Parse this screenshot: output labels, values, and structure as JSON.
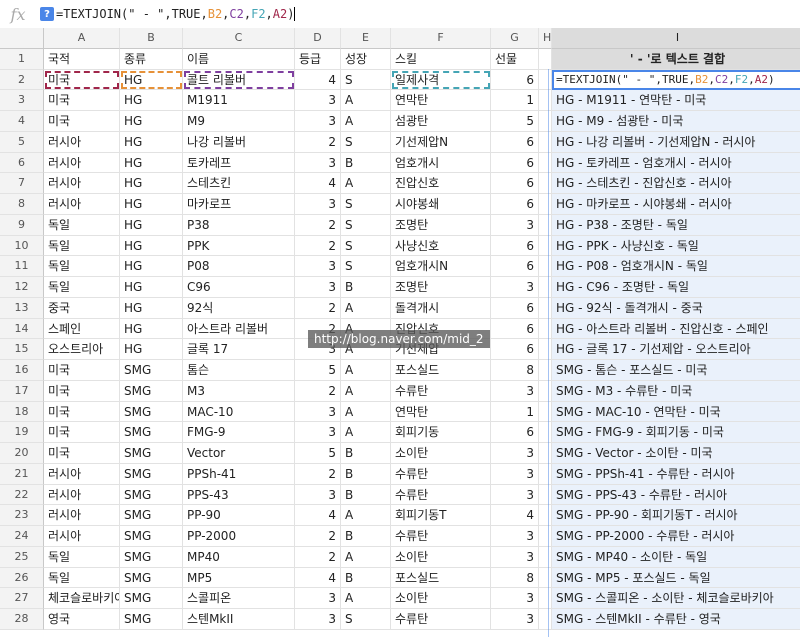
{
  "formula_bar": {
    "fx_label": "fx",
    "help_label": "?",
    "parts": [
      {
        "t": "=TEXTJOIN(\" - \",TRUE,",
        "c": ""
      },
      {
        "t": "B2",
        "c": "t-orange"
      },
      {
        "t": ",",
        "c": ""
      },
      {
        "t": "C2",
        "c": "t-purple"
      },
      {
        "t": ",",
        "c": ""
      },
      {
        "t": "F2",
        "c": "t-teal"
      },
      {
        "t": ",",
        "c": ""
      },
      {
        "t": "A2",
        "c": "t-red"
      },
      {
        "t": ")",
        "c": ""
      }
    ]
  },
  "columns": [
    "A",
    "B",
    "C",
    "D",
    "E",
    "F",
    "G",
    "H",
    "I"
  ],
  "selected_column": "I",
  "headers": {
    "A": "국적",
    "B": "종류",
    "C": "이름",
    "D": "등급",
    "E": "성장",
    "F": "스킬",
    "G": "선물",
    "I": "' - '로 텍스트 결합"
  },
  "rows": [
    {
      "r": "2",
      "A": "미국",
      "B": "HG",
      "C": "콜트 리볼버",
      "D": "4",
      "E": "S",
      "F": "일제사격",
      "G": "6",
      "I": ""
    },
    {
      "r": "3",
      "A": "미국",
      "B": "HG",
      "C": "M1911",
      "D": "3",
      "E": "A",
      "F": "연막탄",
      "G": "1",
      "I": "HG - M1911 - 연막탄 - 미국"
    },
    {
      "r": "4",
      "A": "미국",
      "B": "HG",
      "C": "M9",
      "D": "3",
      "E": "A",
      "F": "섬광탄",
      "G": "5",
      "I": "HG - M9 - 섬광탄 - 미국"
    },
    {
      "r": "5",
      "A": "러시아",
      "B": "HG",
      "C": "나강 리볼버",
      "D": "2",
      "E": "S",
      "F": "기선제압N",
      "G": "6",
      "I": "HG - 나강 리볼버 - 기선제압N - 러시아"
    },
    {
      "r": "6",
      "A": "러시아",
      "B": "HG",
      "C": "토카레프",
      "D": "3",
      "E": "B",
      "F": "엄호개시",
      "G": "6",
      "I": "HG - 토카레프 - 엄호개시 - 러시아"
    },
    {
      "r": "7",
      "A": "러시아",
      "B": "HG",
      "C": "스테츠킨",
      "D": "4",
      "E": "A",
      "F": "진압신호",
      "G": "6",
      "I": "HG - 스테츠킨 - 진압신호 - 러시아"
    },
    {
      "r": "8",
      "A": "러시아",
      "B": "HG",
      "C": "마카로프",
      "D": "3",
      "E": "S",
      "F": "시야봉쇄",
      "G": "6",
      "I": "HG - 마카로프 - 시야봉쇄 - 러시아"
    },
    {
      "r": "9",
      "A": "독일",
      "B": "HG",
      "C": "P38",
      "D": "2",
      "E": "S",
      "F": "조명탄",
      "G": "3",
      "I": "HG - P38 - 조명탄 - 독일"
    },
    {
      "r": "10",
      "A": "독일",
      "B": "HG",
      "C": "PPK",
      "D": "2",
      "E": "S",
      "F": "사냥신호",
      "G": "6",
      "I": "HG - PPK - 사냥신호 - 독일"
    },
    {
      "r": "11",
      "A": "독일",
      "B": "HG",
      "C": "P08",
      "D": "3",
      "E": "S",
      "F": "엄호개시N",
      "G": "6",
      "I": "HG - P08 - 엄호개시N - 독일"
    },
    {
      "r": "12",
      "A": "독일",
      "B": "HG",
      "C": "C96",
      "D": "3",
      "E": "B",
      "F": "조명탄",
      "G": "3",
      "I": "HG - C96 - 조명탄 - 독일"
    },
    {
      "r": "13",
      "A": "중국",
      "B": "HG",
      "C": "92식",
      "D": "2",
      "E": "A",
      "F": "돌격개시",
      "G": "6",
      "I": "HG - 92식 - 돌격개시 - 중국"
    },
    {
      "r": "14",
      "A": "스페인",
      "B": "HG",
      "C": "아스트라 리볼버",
      "D": "2",
      "E": "A",
      "F": "진압신호",
      "G": "6",
      "I": "HG - 아스트라 리볼버 - 진압신호 - 스페인"
    },
    {
      "r": "15",
      "A": "오스트리아",
      "B": "HG",
      "C": "글록 17",
      "D": "3",
      "E": "A",
      "F": "기선제압",
      "G": "6",
      "I": "HG - 글록 17 - 기선제압 - 오스트리아"
    },
    {
      "r": "16",
      "A": "미국",
      "B": "SMG",
      "C": "톰슨",
      "D": "5",
      "E": "A",
      "F": "포스실드",
      "G": "8",
      "I": "SMG - 톰슨 - 포스실드 - 미국"
    },
    {
      "r": "17",
      "A": "미국",
      "B": "SMG",
      "C": "M3",
      "D": "2",
      "E": "A",
      "F": "수류탄",
      "G": "3",
      "I": "SMG - M3 - 수류탄 - 미국"
    },
    {
      "r": "18",
      "A": "미국",
      "B": "SMG",
      "C": "MAC-10",
      "D": "3",
      "E": "A",
      "F": "연막탄",
      "G": "1",
      "I": "SMG - MAC-10 - 연막탄 - 미국"
    },
    {
      "r": "19",
      "A": "미국",
      "B": "SMG",
      "C": "FMG-9",
      "D": "3",
      "E": "A",
      "F": "회피기동",
      "G": "6",
      "I": "SMG - FMG-9 - 회피기동 - 미국"
    },
    {
      "r": "20",
      "A": "미국",
      "B": "SMG",
      "C": "Vector",
      "D": "5",
      "E": "B",
      "F": "소이탄",
      "G": "3",
      "I": "SMG - Vector - 소이탄 - 미국"
    },
    {
      "r": "21",
      "A": "러시아",
      "B": "SMG",
      "C": "PPSh-41",
      "D": "2",
      "E": "B",
      "F": "수류탄",
      "G": "3",
      "I": "SMG - PPSh-41 - 수류탄 - 러시아"
    },
    {
      "r": "22",
      "A": "러시아",
      "B": "SMG",
      "C": "PPS-43",
      "D": "3",
      "E": "B",
      "F": "수류탄",
      "G": "3",
      "I": "SMG - PPS-43 - 수류탄 - 러시아"
    },
    {
      "r": "23",
      "A": "러시아",
      "B": "SMG",
      "C": "PP-90",
      "D": "4",
      "E": "A",
      "F": "회피기동T",
      "G": "4",
      "I": "SMG - PP-90 - 회피기동T - 러시아"
    },
    {
      "r": "24",
      "A": "러시아",
      "B": "SMG",
      "C": "PP-2000",
      "D": "2",
      "E": "B",
      "F": "수류탄",
      "G": "3",
      "I": "SMG - PP-2000 - 수류탄 - 러시아"
    },
    {
      "r": "25",
      "A": "독일",
      "B": "SMG",
      "C": "MP40",
      "D": "2",
      "E": "A",
      "F": "소이탄",
      "G": "3",
      "I": "SMG - MP40 - 소이탄 - 독일"
    },
    {
      "r": "26",
      "A": "독일",
      "B": "SMG",
      "C": "MP5",
      "D": "4",
      "E": "B",
      "F": "포스실드",
      "G": "8",
      "I": "SMG - MP5 - 포스실드 - 독일"
    },
    {
      "r": "27",
      "A": "체코슬로바키아",
      "B": "SMG",
      "C": "스콜피온",
      "D": "3",
      "E": "A",
      "F": "소이탄",
      "G": "3",
      "I": "SMG - 스콜피온 - 소이탄 - 체코슬로바키아"
    },
    {
      "r": "28",
      "A": "영국",
      "B": "SMG",
      "C": "스텐MkII",
      "D": "3",
      "E": "S",
      "F": "수류탄",
      "G": "3",
      "I": "SMG - 스텐MkII - 수류탄 - 영국"
    }
  ],
  "watermark": "http://blog.naver.com/mid_2"
}
